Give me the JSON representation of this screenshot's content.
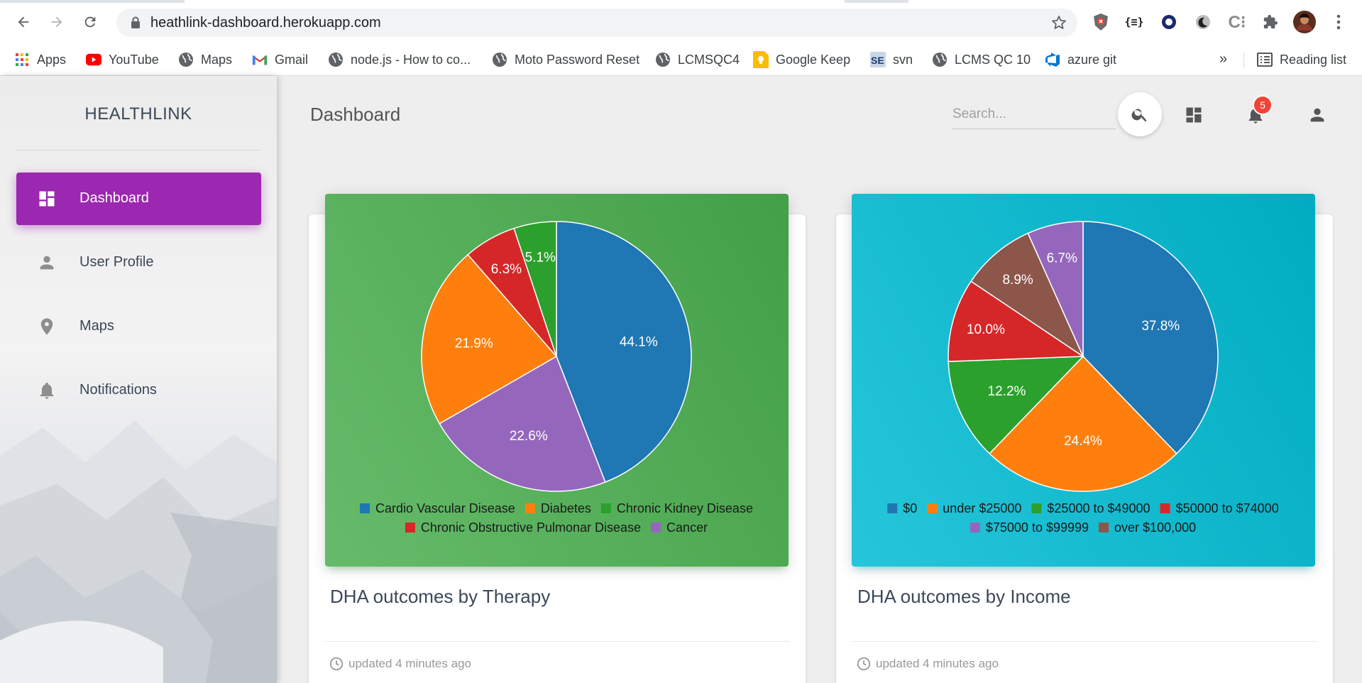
{
  "browser": {
    "url": "heathlink-dashboard.herokuapp.com",
    "bookmarks": [
      {
        "label": "Apps",
        "icon": "apps-grid-icon"
      },
      {
        "label": "YouTube",
        "icon": "youtube-icon"
      },
      {
        "label": "Maps",
        "icon": "globe-icon"
      },
      {
        "label": "Gmail",
        "icon": "gmail-icon"
      },
      {
        "label": "node.js - How to co...",
        "icon": "globe-icon"
      },
      {
        "label": "Moto Password Reset",
        "icon": "globe-icon"
      },
      {
        "label": "LCMSQC4",
        "icon": "globe-icon"
      },
      {
        "label": "Google Keep",
        "icon": "google-keep-icon"
      },
      {
        "label": "svn",
        "icon": "se-icon"
      },
      {
        "label": "LCMS QC 10",
        "icon": "globe-icon"
      },
      {
        "label": "azure git",
        "icon": "azure-devops-icon"
      }
    ],
    "more_label": "»",
    "reading_list": "Reading list"
  },
  "sidebar": {
    "brand": "HEALTHLINK",
    "items": [
      {
        "label": "Dashboard",
        "icon": "dashboard-icon",
        "active": true
      },
      {
        "label": "User Profile",
        "icon": "person-icon",
        "active": false
      },
      {
        "label": "Maps",
        "icon": "location-pin-icon",
        "active": false
      },
      {
        "label": "Notifications",
        "icon": "bell-icon",
        "active": false
      }
    ]
  },
  "header": {
    "title": "Dashboard",
    "search_placeholder": "Search...",
    "notification_count": "5"
  },
  "cards": [
    {
      "title": "DHA outcomes by Therapy",
      "footer": "updated 4 minutes ago"
    },
    {
      "title": "DHA outcomes by Income",
      "footer": "updated 4 minutes ago"
    }
  ],
  "chart_data": [
    {
      "type": "pie",
      "slices": [
        {
          "label": "Cardio Vascular Disease",
          "value": 44.1,
          "color": "#1f77b4"
        },
        {
          "label": "Cancer",
          "value": 22.6,
          "color": "#9467bd"
        },
        {
          "label": "Diabetes",
          "value": 21.9,
          "color": "#ff7f0e"
        },
        {
          "label": "Chronic Obstructive Pulmonar Disease",
          "value": 6.3,
          "color": "#d62728"
        },
        {
          "label": "Chronic Kidney Disease",
          "value": 5.1,
          "color": "#2ca02c"
        }
      ],
      "legend": {
        "rows": [
          [
            {
              "label": "Cardio Vascular Disease",
              "color": "#1f77b4"
            },
            {
              "label": "Diabetes",
              "color": "#ff7f0e"
            },
            {
              "label": "Chronic Kidney Disease",
              "color": "#2ca02c"
            }
          ],
          [
            {
              "label": "Chronic Obstructive Pulmonar Disease",
              "color": "#d62728"
            },
            {
              "label": "Cancer",
              "color": "#9467bd"
            }
          ]
        ]
      }
    },
    {
      "type": "pie",
      "slices": [
        {
          "label": "$0",
          "value": 37.8,
          "color": "#1f77b4"
        },
        {
          "label": "under $25000",
          "value": 24.4,
          "color": "#ff7f0e"
        },
        {
          "label": "$25000 to $49000",
          "value": 12.2,
          "color": "#2ca02c"
        },
        {
          "label": "$50000 to $74000",
          "value": 10.0,
          "color": "#d62728"
        },
        {
          "label": "over $100,000",
          "value": 8.9,
          "color": "#8c564b"
        },
        {
          "label": "$75000 to $99999",
          "value": 6.7,
          "color": "#9467bd"
        }
      ],
      "legend": {
        "rows": [
          [
            {
              "label": "$0",
              "color": "#1f77b4"
            },
            {
              "label": "under $25000",
              "color": "#ff7f0e"
            },
            {
              "label": "$25000 to $49000",
              "color": "#2ca02c"
            },
            {
              "label": "$50000 to $74000",
              "color": "#d62728"
            }
          ],
          [
            {
              "label": "$75000 to $99999",
              "color": "#9467bd"
            },
            {
              "label": "over $100,000",
              "color": "#8c564b"
            }
          ]
        ]
      }
    }
  ]
}
